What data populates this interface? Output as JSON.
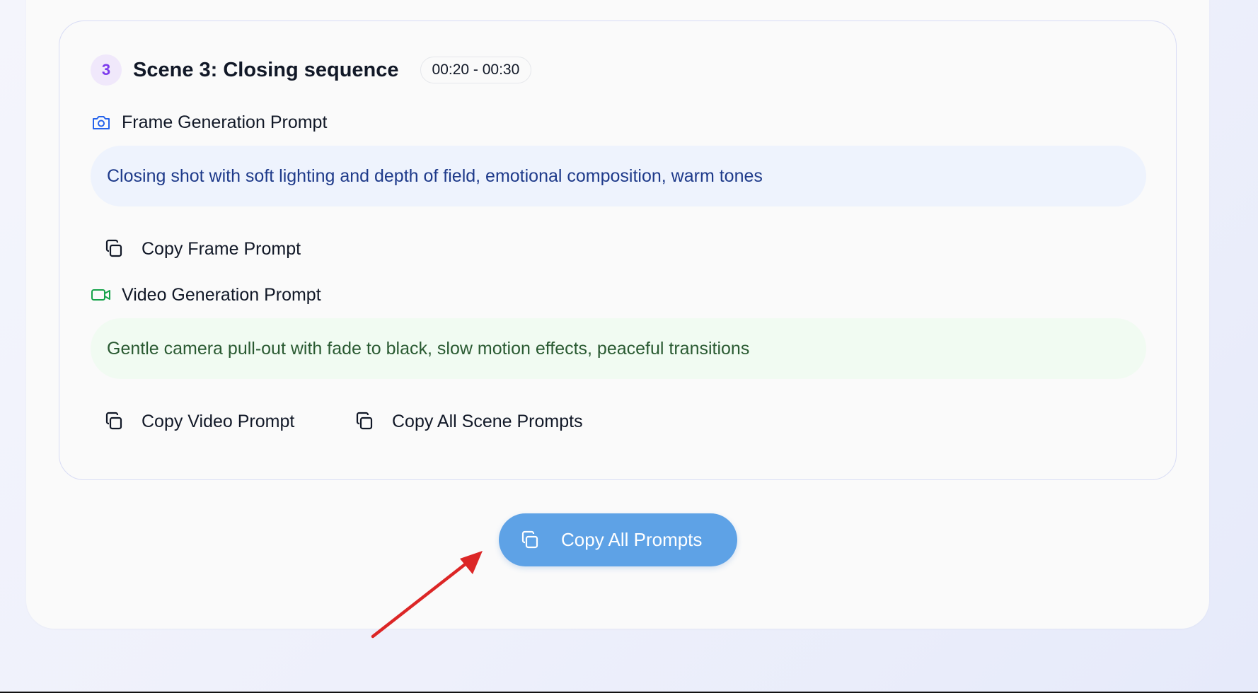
{
  "scene": {
    "number": "3",
    "title": "Scene 3: Closing sequence",
    "time_range": "00:20 - 00:30",
    "frame_section": {
      "label": "Frame Generation Prompt",
      "icon": "camera-icon",
      "prompt": "Closing shot with soft lighting and depth of field, emotional composition, warm tones",
      "copy_label": "Copy Frame Prompt"
    },
    "video_section": {
      "label": "Video Generation Prompt",
      "icon": "video-icon",
      "prompt": "Gentle camera pull-out with fade to black, slow motion effects, peaceful transitions",
      "copy_label": "Copy Video Prompt"
    },
    "copy_all_scene_label": "Copy All Scene Prompts"
  },
  "footer": {
    "copy_all_label": "Copy All Prompts"
  },
  "colors": {
    "accent_button": "#5ea2e6",
    "scene_badge": "#7c3aed",
    "frame_icon": "#2563eb",
    "video_icon": "#16a34a",
    "annotation_arrow": "#dc2626"
  }
}
